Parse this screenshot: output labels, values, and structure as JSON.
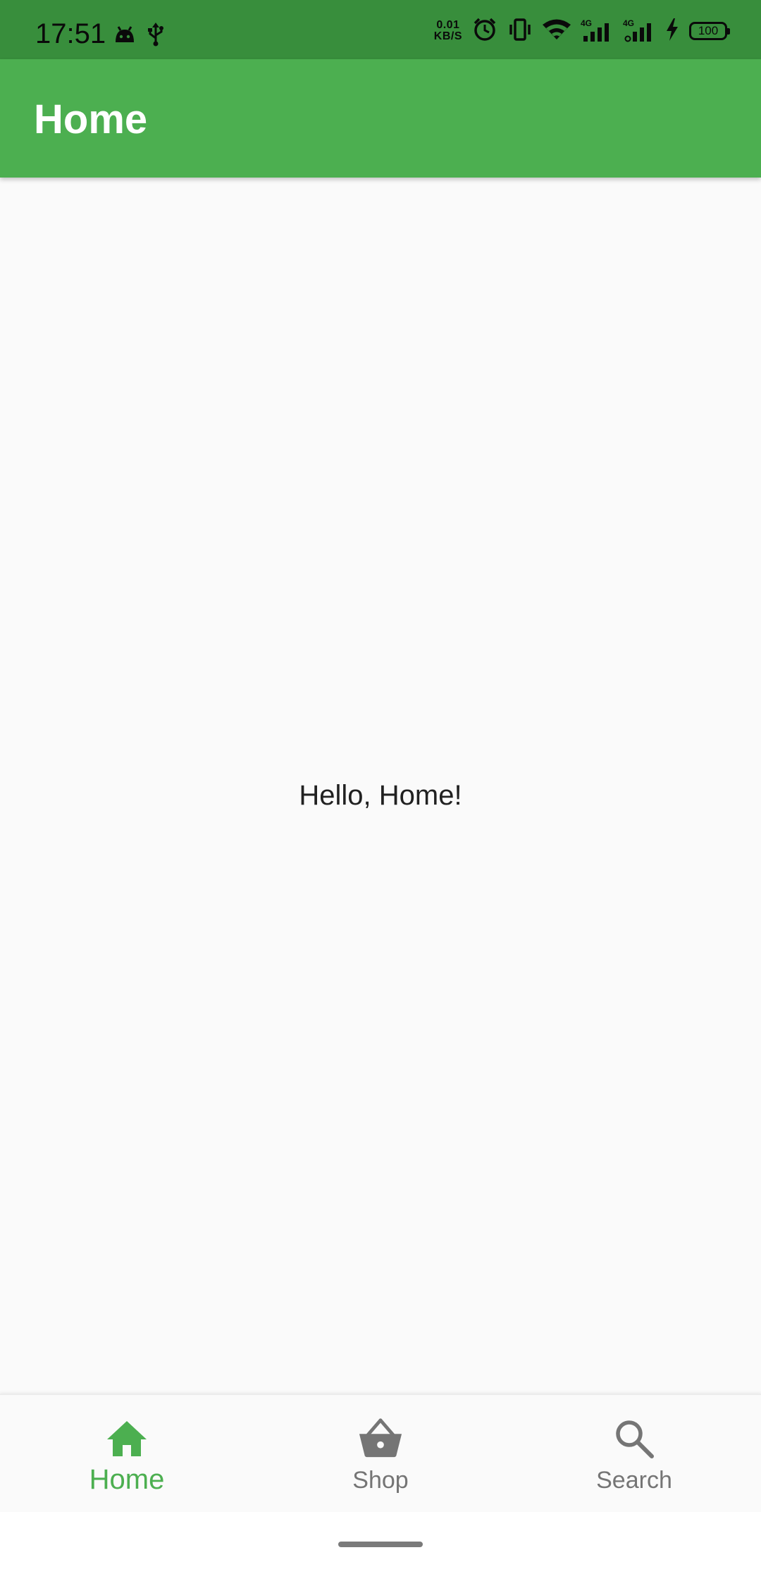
{
  "status_bar": {
    "time": "17:51",
    "net_speed_value": "0.01",
    "net_speed_unit": "KB/S",
    "signal_1_label": "4G",
    "signal_2_label": "4G",
    "battery_level": "100",
    "background_color": "#388e3c"
  },
  "app_bar": {
    "title": "Home",
    "background_color": "#4caf50"
  },
  "body": {
    "message": "Hello, Home!"
  },
  "bottom_nav": {
    "items": [
      {
        "label": "Home",
        "icon": "home-icon",
        "active": true
      },
      {
        "label": "Shop",
        "icon": "shopping-basket-icon",
        "active": false
      },
      {
        "label": "Search",
        "icon": "search-icon",
        "active": false
      }
    ],
    "active_color": "#4caf50",
    "inactive_color": "#757575"
  }
}
